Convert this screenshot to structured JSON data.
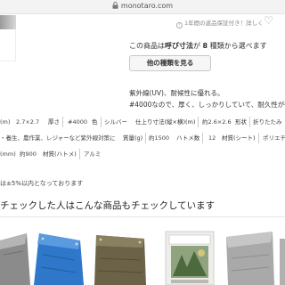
{
  "browser": {
    "url": "monotaro.com"
  },
  "header": {
    "return_policy": "1年間の返品保証付き！詳しく",
    "policy_icon": "?",
    "favorite": "♡"
  },
  "variants": {
    "prefix": "この商品は",
    "dimension": "呼び寸法",
    "middle": "が",
    "count": "8",
    "suffix": "種類から選べます",
    "button_label": "他の種類を見る"
  },
  "description": {
    "line1": "紫外線(UV)、耐候性に優れる。",
    "line2": "#4000なので、厚く、しっかりしていて、耐久性が強"
  },
  "specs": {
    "row1": [
      {
        "text": "(m)",
        "kind": "val"
      },
      {
        "text": "2.7×2.7",
        "kind": "val"
      },
      {
        "text": "厚さ",
        "kind": "lbl"
      },
      {
        "text": "#4000",
        "kind": "val"
      },
      {
        "text": "色",
        "kind": "lbl"
      },
      {
        "text": "シルバー",
        "kind": "val"
      },
      {
        "text": "仕上り寸法(縦×横)(m)",
        "kind": "lbl"
      },
      {
        "text": "約2.6×2.6",
        "kind": "val"
      },
      {
        "text": "形状",
        "kind": "lbl"
      },
      {
        "text": "折りたたみ",
        "kind": "val"
      }
    ],
    "row2": [
      {
        "text": "・養生、農作業、レジャーなど紫外線対策に",
        "kind": "val"
      },
      {
        "text": "質量(g)",
        "kind": "lbl"
      },
      {
        "text": "約1500",
        "kind": "val"
      },
      {
        "text": "ハトメ数",
        "kind": "lbl"
      },
      {
        "text": "12",
        "kind": "val"
      },
      {
        "text": "材質(シート)",
        "kind": "lbl"
      },
      {
        "text": "ポリエチ",
        "kind": "val"
      }
    ],
    "row3": [
      {
        "text": "(mm)",
        "kind": "val"
      },
      {
        "text": "約900",
        "kind": "val"
      },
      {
        "text": "材質(ハトメ)",
        "kind": "lbl"
      },
      {
        "text": "アルミ",
        "kind": "val"
      }
    ]
  },
  "note": "は±5%以内となっております",
  "recommendations": {
    "title": "チェックした人はこんな商品もチェックしています",
    "products": [
      {
        "name": "silver-sheet",
        "color": "#8e8e8e"
      },
      {
        "name": "blue-sheet",
        "color": "#2f78c9"
      },
      {
        "name": "olive-sheet",
        "color": "#6b6247"
      },
      {
        "name": "packaged-sheet",
        "color": "#c7c7bf"
      },
      {
        "name": "gray-sheet",
        "color": "#a9a9a9"
      }
    ]
  },
  "colors": {
    "accent": "#333333",
    "button_bg": "#f6f6f6",
    "url_bar": "#f3f3f3"
  }
}
